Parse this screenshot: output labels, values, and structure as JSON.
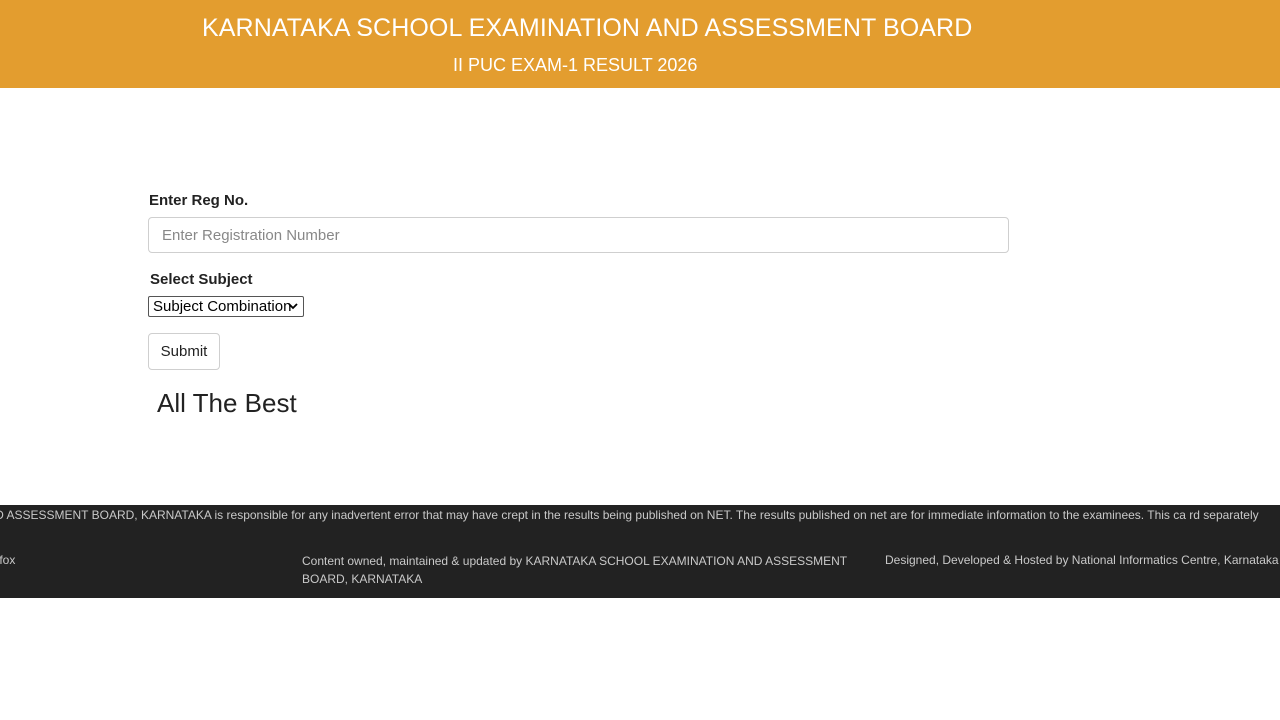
{
  "header": {
    "title": "KARNATAKA SCHOOL EXAMINATION AND ASSESSMENT BOARD",
    "subtitle": "II PUC EXAM-1 RESULT 2026",
    "background_color": "#e39d2f"
  },
  "form": {
    "reg_label": "Enter Reg No.",
    "reg_placeholder": "Enter Registration Number",
    "reg_value": "",
    "subject_label": "Select Subject",
    "subject_selected": "Subject Combination",
    "submit_label": "Submit"
  },
  "message": "All The Best",
  "footer": {
    "disclaimer": "EXAMINATION AND ASSESSMENT BOARD, KARNATAKA is responsible for any inadvertent error that may have crept in the results being published on NET. The results published on net are for immediate information to the examinees. This ca rd separately",
    "browser_note": "ozilla Firefox",
    "content_owned": "Content owned, maintained & updated by KARNATAKA SCHOOL EXAMINATION AND ASSESSMENT BOARD, KARNATAKA",
    "designed_by": "Designed, Developed & Hosted by National Informatics Centre, Karnataka",
    "background_color": "#222222"
  },
  "icons": {
    "select_arrow": "chevron-down-icon"
  }
}
